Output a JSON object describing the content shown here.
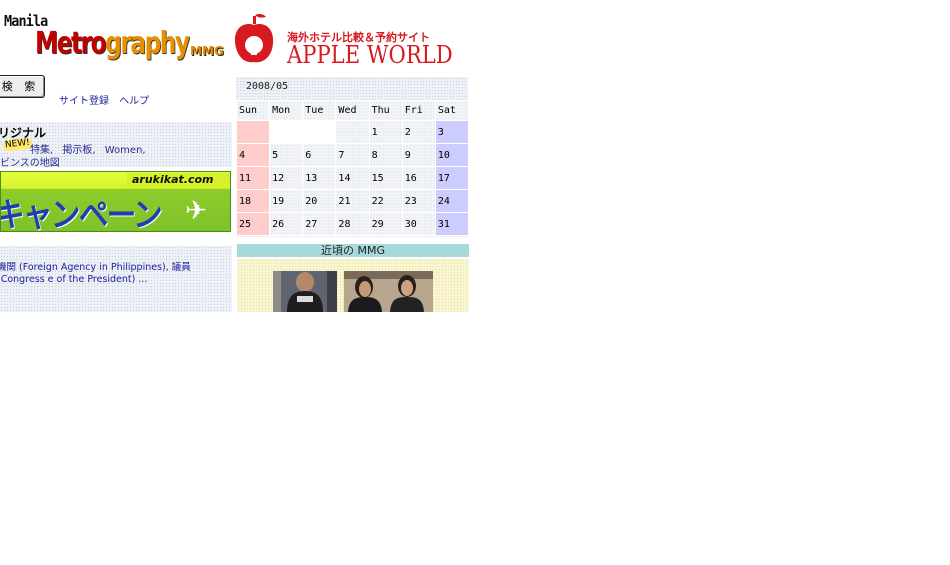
{
  "metrography": {
    "manila": "Manila",
    "metro_part1": "Metro",
    "metro_part2": "graphy",
    "mmg": "MMG"
  },
  "search": {
    "button_label": "検 索",
    "links": [
      "サイト登録",
      "ヘルプ"
    ]
  },
  "original": {
    "title": "リジナル",
    "new_badge": "NEW!",
    "links": [
      "特集,",
      "掲示板,",
      "Women,"
    ],
    "map_link": "ビンスの地図"
  },
  "campaign": {
    "logo_text": "arukikat.com",
    "text": "キャンペーン"
  },
  "links_text": "機関 (Foreign Agency in Philippines), 議員 (Congress e of the President) ...",
  "apple_world": {
    "tagline": "海外ホテル比較＆予約サイト",
    "name": "APPLE WORLD",
    "brand_color": "#d71920"
  },
  "calendar": {
    "month": "2008/05",
    "days": [
      "Sun",
      "Mon",
      "Tue",
      "Wed",
      "Thu",
      "Fri",
      "Sat"
    ],
    "weeks": [
      [
        "",
        "",
        "",
        "",
        "1",
        "2",
        "3"
      ],
      [
        "4",
        "5",
        "6",
        "7",
        "8",
        "9",
        "10"
      ],
      [
        "11",
        "12",
        "13",
        "14",
        "15",
        "16",
        "17"
      ],
      [
        "18",
        "19",
        "20",
        "21",
        "22",
        "23",
        "24"
      ],
      [
        "25",
        "26",
        "27",
        "28",
        "29",
        "30",
        "31"
      ]
    ],
    "sunday_color": "#ffcccc",
    "saturday_color": "#ccccff"
  },
  "mmg_recent": {
    "header": "近頃の MMG"
  }
}
